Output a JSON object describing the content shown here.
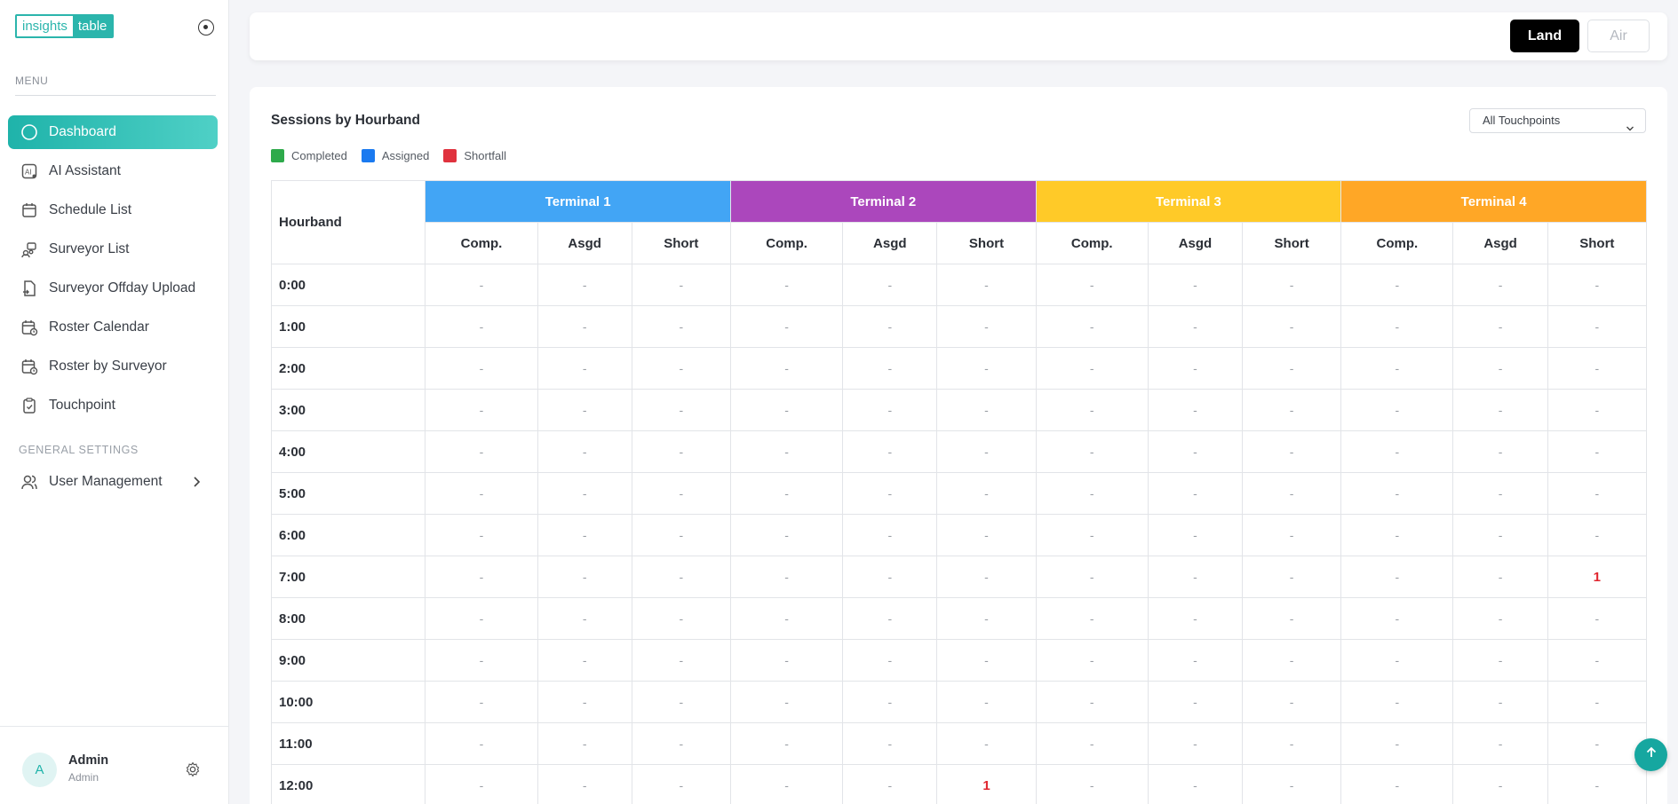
{
  "logo": {
    "part1": "insights",
    "part2": "table"
  },
  "sidebar": {
    "menu_label": "MENU",
    "items": [
      {
        "label": "Dashboard",
        "icon": "circle-icon",
        "active": true
      },
      {
        "label": "AI Assistant",
        "icon": "ai-icon"
      },
      {
        "label": "Schedule List",
        "icon": "calendar-icon"
      },
      {
        "label": "Surveyor List",
        "icon": "users-icon"
      },
      {
        "label": "Surveyor Offday Upload",
        "icon": "file-upload-icon"
      },
      {
        "label": "Roster Calendar",
        "icon": "calendar-clock-icon"
      },
      {
        "label": "Roster by Surveyor",
        "icon": "calendar-clock-icon"
      },
      {
        "label": "Touchpoint",
        "icon": "clipboard-icon"
      }
    ],
    "settings_label": "GENERAL SETTINGS",
    "user_management": "User Management"
  },
  "user": {
    "initial": "A",
    "name": "Admin",
    "role": "Admin"
  },
  "topbar": {
    "land": "Land",
    "air": "Air"
  },
  "panel": {
    "title": "Sessions by Hourband",
    "filter": "All Touchpoints",
    "legend": [
      {
        "label": "Completed",
        "color": "#2eaa4b"
      },
      {
        "label": "Assigned",
        "color": "#1a7af0"
      },
      {
        "label": "Shortfall",
        "color": "#e0323e"
      }
    ]
  },
  "table": {
    "hourband_header": "Hourband",
    "terminals": [
      {
        "name": "Terminal 1",
        "color": "#42a5f5"
      },
      {
        "name": "Terminal 2",
        "color": "#ab47bc"
      },
      {
        "name": "Terminal 3",
        "color": "#ffca28"
      },
      {
        "name": "Terminal 4",
        "color": "#ffa726"
      }
    ],
    "sub_headers": [
      "Comp.",
      "Asgd",
      "Short"
    ],
    "rows": [
      {
        "hour": "0:00",
        "cells": [
          "-",
          "-",
          "-",
          "-",
          "-",
          "-",
          "-",
          "-",
          "-",
          "-",
          "-",
          "-"
        ]
      },
      {
        "hour": "1:00",
        "cells": [
          "-",
          "-",
          "-",
          "-",
          "-",
          "-",
          "-",
          "-",
          "-",
          "-",
          "-",
          "-"
        ]
      },
      {
        "hour": "2:00",
        "cells": [
          "-",
          "-",
          "-",
          "-",
          "-",
          "-",
          "-",
          "-",
          "-",
          "-",
          "-",
          "-"
        ]
      },
      {
        "hour": "3:00",
        "cells": [
          "-",
          "-",
          "-",
          "-",
          "-",
          "-",
          "-",
          "-",
          "-",
          "-",
          "-",
          "-"
        ]
      },
      {
        "hour": "4:00",
        "cells": [
          "-",
          "-",
          "-",
          "-",
          "-",
          "-",
          "-",
          "-",
          "-",
          "-",
          "-",
          "-"
        ]
      },
      {
        "hour": "5:00",
        "cells": [
          "-",
          "-",
          "-",
          "-",
          "-",
          "-",
          "-",
          "-",
          "-",
          "-",
          "-",
          "-"
        ]
      },
      {
        "hour": "6:00",
        "cells": [
          "-",
          "-",
          "-",
          "-",
          "-",
          "-",
          "-",
          "-",
          "-",
          "-",
          "-",
          "-"
        ]
      },
      {
        "hour": "7:00",
        "cells": [
          "-",
          "-",
          "-",
          "-",
          "-",
          "-",
          "-",
          "-",
          "-",
          "-",
          "-",
          "1"
        ]
      },
      {
        "hour": "8:00",
        "cells": [
          "-",
          "-",
          "-",
          "-",
          "-",
          "-",
          "-",
          "-",
          "-",
          "-",
          "-",
          "-"
        ]
      },
      {
        "hour": "9:00",
        "cells": [
          "-",
          "-",
          "-",
          "-",
          "-",
          "-",
          "-",
          "-",
          "-",
          "-",
          "-",
          "-"
        ]
      },
      {
        "hour": "10:00",
        "cells": [
          "-",
          "-",
          "-",
          "-",
          "-",
          "-",
          "-",
          "-",
          "-",
          "-",
          "-",
          "-"
        ]
      },
      {
        "hour": "11:00",
        "cells": [
          "-",
          "-",
          "-",
          "-",
          "-",
          "-",
          "-",
          "-",
          "-",
          "-",
          "-",
          "-"
        ]
      },
      {
        "hour": "12:00",
        "cells": [
          "-",
          "-",
          "-",
          "-",
          "-",
          "1",
          "-",
          "-",
          "-",
          "-",
          "-",
          "-"
        ]
      }
    ]
  }
}
